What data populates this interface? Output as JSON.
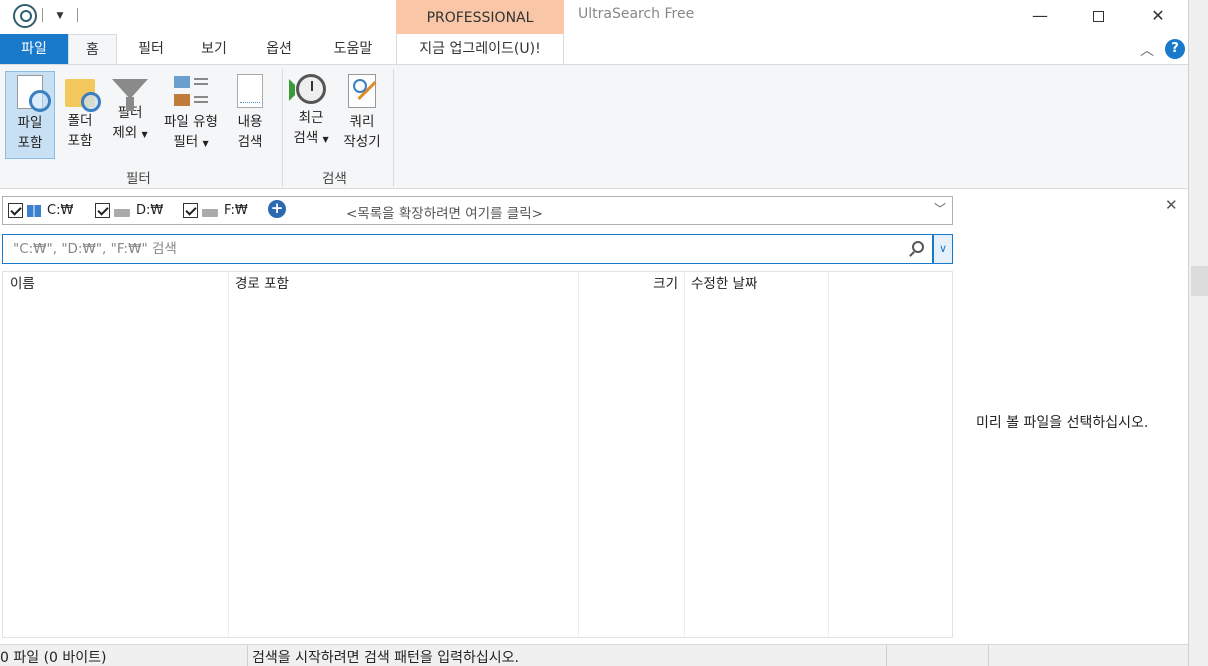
{
  "window": {
    "title": "UltraSearch Free",
    "pro_tab": "PROFESSIONAL",
    "minimize": "—",
    "close": "✕"
  },
  "tabs": {
    "file": "파일",
    "home": "홈",
    "filter": "필터",
    "view": "보기",
    "options": "옵션",
    "help": "도움말",
    "upgrade": "지금 업그레이드(U)!"
  },
  "ribbon": {
    "include_file": [
      "파일",
      "포함"
    ],
    "include_folder": [
      "폴더",
      "포함"
    ],
    "exclude_filter": [
      "필터",
      "제외"
    ],
    "file_type_filter": [
      "파일 유형",
      "필터"
    ],
    "content_search": [
      "내용",
      "검색"
    ],
    "recent_search": [
      "최근",
      "검색"
    ],
    "query_builder": [
      "쿼리",
      "작성기"
    ],
    "group_filter": "필터",
    "group_search": "검색"
  },
  "drives": {
    "c": "C:₩",
    "d": "D:₩",
    "f": "F:₩",
    "expand_hint": "<목록을 확장하려면 여기를 클릭>"
  },
  "search": {
    "placeholder": "\"C:₩\", \"D:₩\", \"F:₩\" 검색"
  },
  "columns": {
    "name": "이름",
    "path": "경로 포함",
    "size": "크기",
    "modified": "수정한 날짜"
  },
  "preview": {
    "message": "미리 볼 파일을 선택하십시오."
  },
  "status": {
    "count": "0 파일 (0 바이트)",
    "message": "검색을 시작하려면 검색 패턴을 입력하십시오."
  },
  "colors": {
    "accent": "#1979ca",
    "pro_tab": "#f9c7a8",
    "ribbon_bg": "#f5f6f7"
  }
}
